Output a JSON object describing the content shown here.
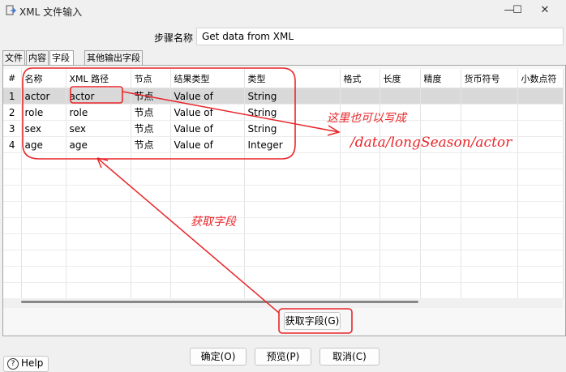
{
  "window": {
    "title": "XML 文件输入",
    "minimize_glyph": "—",
    "maximize_glyph": "☐",
    "close_glyph": "✕"
  },
  "step": {
    "label": "步骤名称",
    "value": "Get data from XML"
  },
  "tabs": [
    {
      "label": "文件"
    },
    {
      "label": "内容"
    },
    {
      "label": "字段"
    },
    {
      "label": "其他输出字段"
    }
  ],
  "grid": {
    "columns": [
      "#",
      "名称",
      "XML 路径",
      "节点",
      "结果类型",
      "类型",
      "格式",
      "长度",
      "精度",
      "货币符号",
      "小数点符"
    ],
    "rows": [
      [
        "1",
        "actor",
        "actor",
        "节点",
        "Value of",
        "String"
      ],
      [
        "2",
        "role",
        "role",
        "节点",
        "Value of",
        "String"
      ],
      [
        "3",
        "sex",
        "sex",
        "节点",
        "Value of",
        "String"
      ],
      [
        "4",
        "age",
        "age",
        "节点",
        "Value of",
        "Integer"
      ]
    ]
  },
  "buttons": {
    "get_fields": "获取字段(G)",
    "ok": "确定(O)",
    "preview": "预览(P)",
    "cancel": "取消(C)",
    "help": "Help"
  },
  "annotations": {
    "note_line1": "这里也可以写成",
    "note_line2": "/data/longSeason/actor",
    "get_fields_note": "获取字段",
    "color": "#e8262a"
  }
}
